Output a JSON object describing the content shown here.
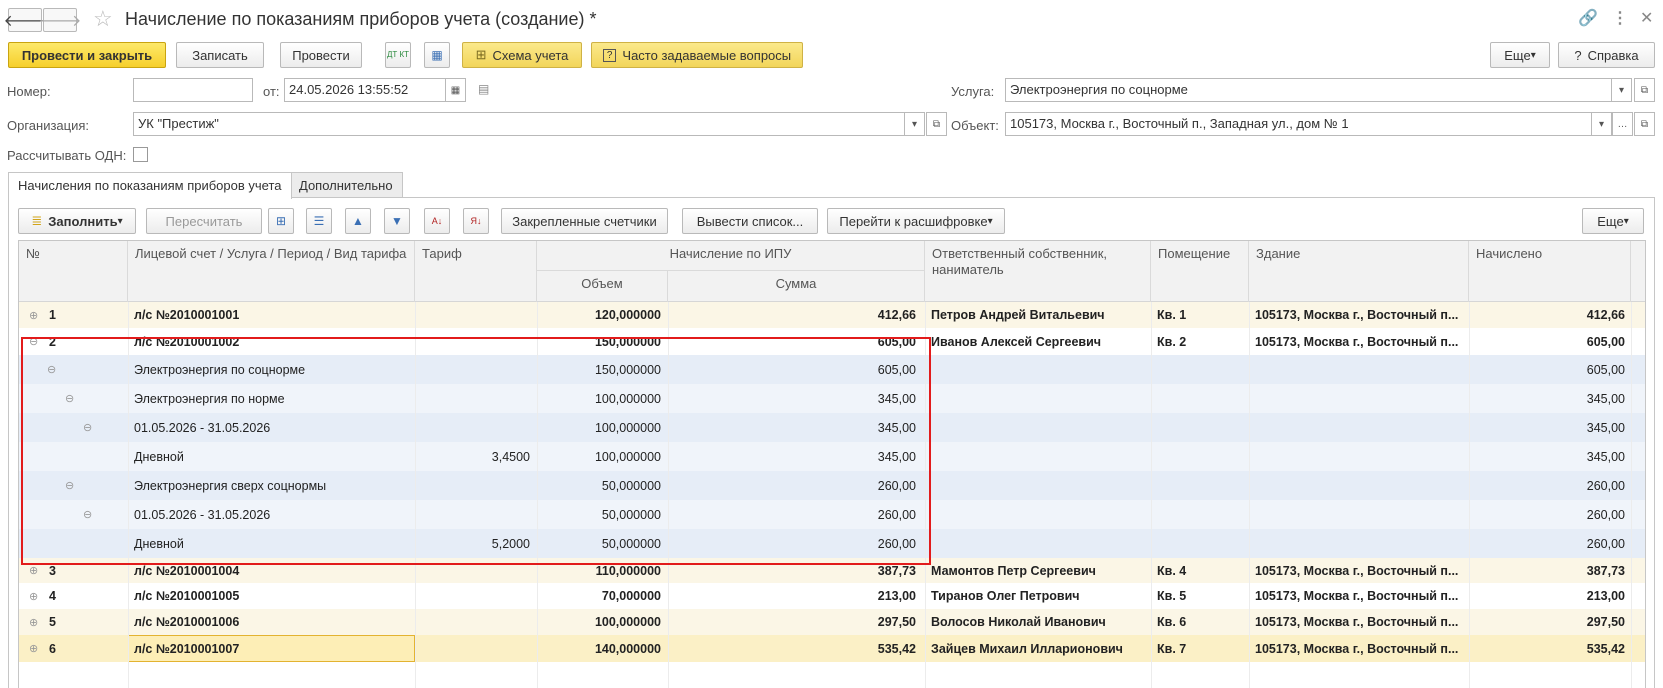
{
  "window": {
    "title": "Начисление по показаниям приборов учета (создание) *"
  },
  "toolbar": {
    "post_close": "Провести и закрыть",
    "save": "Записать",
    "post": "Провести",
    "dt_kt_label": "ДТ КТ",
    "scheme": "Схема учета",
    "faq": "Часто задаваемые вопросы",
    "more": "Еще",
    "help": "Справка"
  },
  "form": {
    "number_label": "Номер:",
    "number_value": "",
    "date_label": "от:",
    "date_value": "24.05.2026 13:55:52",
    "org_label": "Организация:",
    "org_value": "УК \"Престиж\"",
    "odn_label": "Рассчитывать ОДН:",
    "service_label": "Услуга:",
    "service_value": "Электроэнергия по соцнорме",
    "object_label": "Объект:",
    "object_value": "105173, Москва г., Восточный п., Западная ул., дом № 1"
  },
  "tabs": [
    {
      "label": "Начисления по показаниям приборов учета"
    },
    {
      "label": "Дополнительно"
    }
  ],
  "grid_toolbar": {
    "fill": "Заполнить",
    "recalc": "Пересчитать",
    "fixed_meters": "Закрепленные счетчики",
    "output_list": "Вывести список...",
    "go_decode": "Перейти к расшифровке",
    "more": "Еще"
  },
  "grid": {
    "headers": {
      "num": "№",
      "account": "Лицевой счет / Услуга / Период / Вид тарифа",
      "tariff": "Тариф",
      "ipu": "Начисление по ИПУ",
      "volume": "Объем",
      "sum": "Сумма",
      "owner": "Ответственный собственник, наниматель",
      "room": "Помещение",
      "building": "Здание",
      "charged": "Начислено"
    },
    "rows": [
      {
        "num": "1",
        "account": "л/с №2010001001",
        "tariff": "",
        "volume": "120,000000",
        "sum": "412,66",
        "owner": "Петров Андрей Витальевич",
        "room": "Кв. 1",
        "building": "105173, Москва г., Восточный п...",
        "charged": "412,66"
      },
      {
        "num": "2",
        "account": "л/с №2010001002",
        "tariff": "",
        "volume": "150,000000",
        "sum": "605,00",
        "owner": "Иванов Алексей Сергеевич",
        "room": "Кв. 2",
        "building": "105173, Москва г., Восточный п...",
        "charged": "605,00"
      },
      {
        "num": "",
        "account": "Электроэнергия по соцнорме",
        "tariff": "",
        "volume": "150,000000",
        "sum": "605,00",
        "owner": "",
        "room": "",
        "building": "",
        "charged": "605,00"
      },
      {
        "num": "",
        "account": "Электроэнергия по норме",
        "tariff": "",
        "volume": "100,000000",
        "sum": "345,00",
        "owner": "",
        "room": "",
        "building": "",
        "charged": "345,00"
      },
      {
        "num": "",
        "account": "01.05.2026 - 31.05.2026",
        "tariff": "",
        "volume": "100,000000",
        "sum": "345,00",
        "owner": "",
        "room": "",
        "building": "",
        "charged": "345,00"
      },
      {
        "num": "",
        "account": "Дневной",
        "tariff": "3,4500",
        "volume": "100,000000",
        "sum": "345,00",
        "owner": "",
        "room": "",
        "building": "",
        "charged": "345,00"
      },
      {
        "num": "",
        "account": "Электроэнергия сверх соцнормы",
        "tariff": "",
        "volume": "50,000000",
        "sum": "260,00",
        "owner": "",
        "room": "",
        "building": "",
        "charged": "260,00"
      },
      {
        "num": "",
        "account": "01.05.2026 - 31.05.2026",
        "tariff": "",
        "volume": "50,000000",
        "sum": "260,00",
        "owner": "",
        "room": "",
        "building": "",
        "charged": "260,00"
      },
      {
        "num": "",
        "account": "Дневной",
        "tariff": "5,2000",
        "volume": "50,000000",
        "sum": "260,00",
        "owner": "",
        "room": "",
        "building": "",
        "charged": "260,00"
      },
      {
        "num": "3",
        "account": "л/с №2010001004",
        "tariff": "",
        "volume": "110,000000",
        "sum": "387,73",
        "owner": "Мамонтов Петр Сергеевич",
        "room": "Кв. 4",
        "building": "105173, Москва г., Восточный п...",
        "charged": "387,73"
      },
      {
        "num": "4",
        "account": "л/с №2010001005",
        "tariff": "",
        "volume": "70,000000",
        "sum": "213,00",
        "owner": "Тиранов Олег Петрович",
        "room": "Кв. 5",
        "building": "105173, Москва г., Восточный п...",
        "charged": "213,00"
      },
      {
        "num": "5",
        "account": "л/с №2010001006",
        "tariff": "",
        "volume": "100,000000",
        "sum": "297,50",
        "owner": "Волосов Николай Иванович",
        "room": "Кв. 6",
        "building": "105173, Москва г., Восточный п...",
        "charged": "297,50"
      },
      {
        "num": "6",
        "account": "л/с №2010001007",
        "tariff": "",
        "volume": "140,000000",
        "sum": "535,42",
        "owner": "Зайцев Михаил Илларионович",
        "room": "Кв. 7",
        "building": "105173, Москва г., Восточный п...",
        "charged": "535,42"
      }
    ]
  }
}
